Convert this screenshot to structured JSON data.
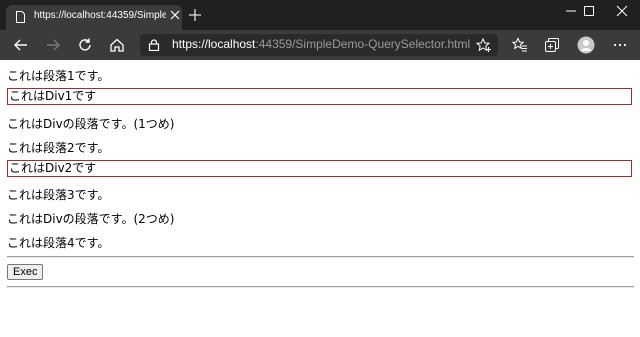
{
  "browser": {
    "tab_title": "https://localhost:44359/SimpleD",
    "url_host": "https://localhost",
    "url_rest": ":44359/SimpleDemo-QuerySelector.html"
  },
  "icons": [
    "page-icon",
    "close-icon",
    "plus-icon",
    "minimize-icon",
    "maximize-icon",
    "close-window-icon",
    "back-icon",
    "forward-icon",
    "reload-icon",
    "home-icon",
    "lock-icon",
    "star-add-icon",
    "favorites-icon",
    "collections-icon",
    "profile-icon",
    "more-icon"
  ],
  "page": {
    "para1": "これは段落1です。",
    "div1": "これはDiv1です",
    "div_para1": "これはDivの段落です。(1つめ)",
    "para2": "これは段落2です。",
    "div2": "これはDiv2です",
    "para3": "これは段落3です。",
    "div_para2": "これはDivの段落です。(2つめ)",
    "para4": "これは段落4です。",
    "exec_label": "Exec"
  }
}
